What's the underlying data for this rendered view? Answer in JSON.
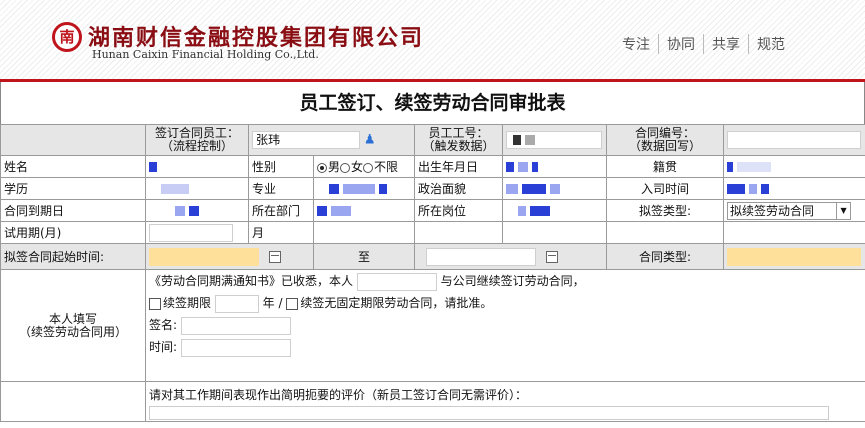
{
  "header": {
    "logo_char": "南",
    "company_cn": "湖南财信金融控股集团有限公司",
    "company_en": "Hunan Caixin Financial Holding Co.,Ltd.",
    "slogan": [
      "专注",
      "协同",
      "共享",
      "规范"
    ]
  },
  "title": "员工签订、续签劳动合同审批表",
  "row1": {
    "employee_label_1": "签订合同员工：",
    "employee_label_2": "（流程控制）",
    "employee_value": "张玮",
    "employee_no_label_1": "员工工号：",
    "employee_no_label_2": "（触发数据）",
    "contract_no_label_1": "合同编号：",
    "contract_no_label_2": "（数据回写）"
  },
  "row2": {
    "name_label": "姓名",
    "gender_label": "性别",
    "gender_options": [
      "男",
      "女",
      "不限"
    ],
    "gender_selected": "男",
    "birth_label": "出生年月日",
    "native_label": "籍贯"
  },
  "row3": {
    "education_label": "学历",
    "major_label": "专业",
    "political_label": "政治面貌",
    "join_date_label": "入司时间"
  },
  "row4": {
    "expire_label": "合同到期日",
    "dept_label": "所在部门",
    "post_label": "所在岗位",
    "sign_type_label": "拟签类型:",
    "sign_type_value": "拟续签劳动合同"
  },
  "row5": {
    "probation_label": "试用期(月)",
    "month_unit": "月"
  },
  "row6": {
    "start_label": "拟签合同起始时间:",
    "to_label": "至",
    "contract_type_label": "合同类型:"
  },
  "section": {
    "label_1": "本人填写",
    "label_2": "（续签劳动合同用）",
    "line1_a": "《劳动合同期满通知书》已收悉，本人",
    "line1_b": "与公司继续签订劳动合同，",
    "renew_term": "续签期限",
    "years": "年 /",
    "renew_open": "续签无固定期限劳动合同，请批准。",
    "sign": "签名:",
    "time": "时间:"
  },
  "evaluation": {
    "prompt": "请对其工作期间表现作出简明扼要的评价（新员工签订合同无需评价）："
  },
  "colors": {
    "brand_red": "#c0141c",
    "highlight_yellow": "#ffe09a",
    "blur_blue": "#2a3fd6"
  }
}
